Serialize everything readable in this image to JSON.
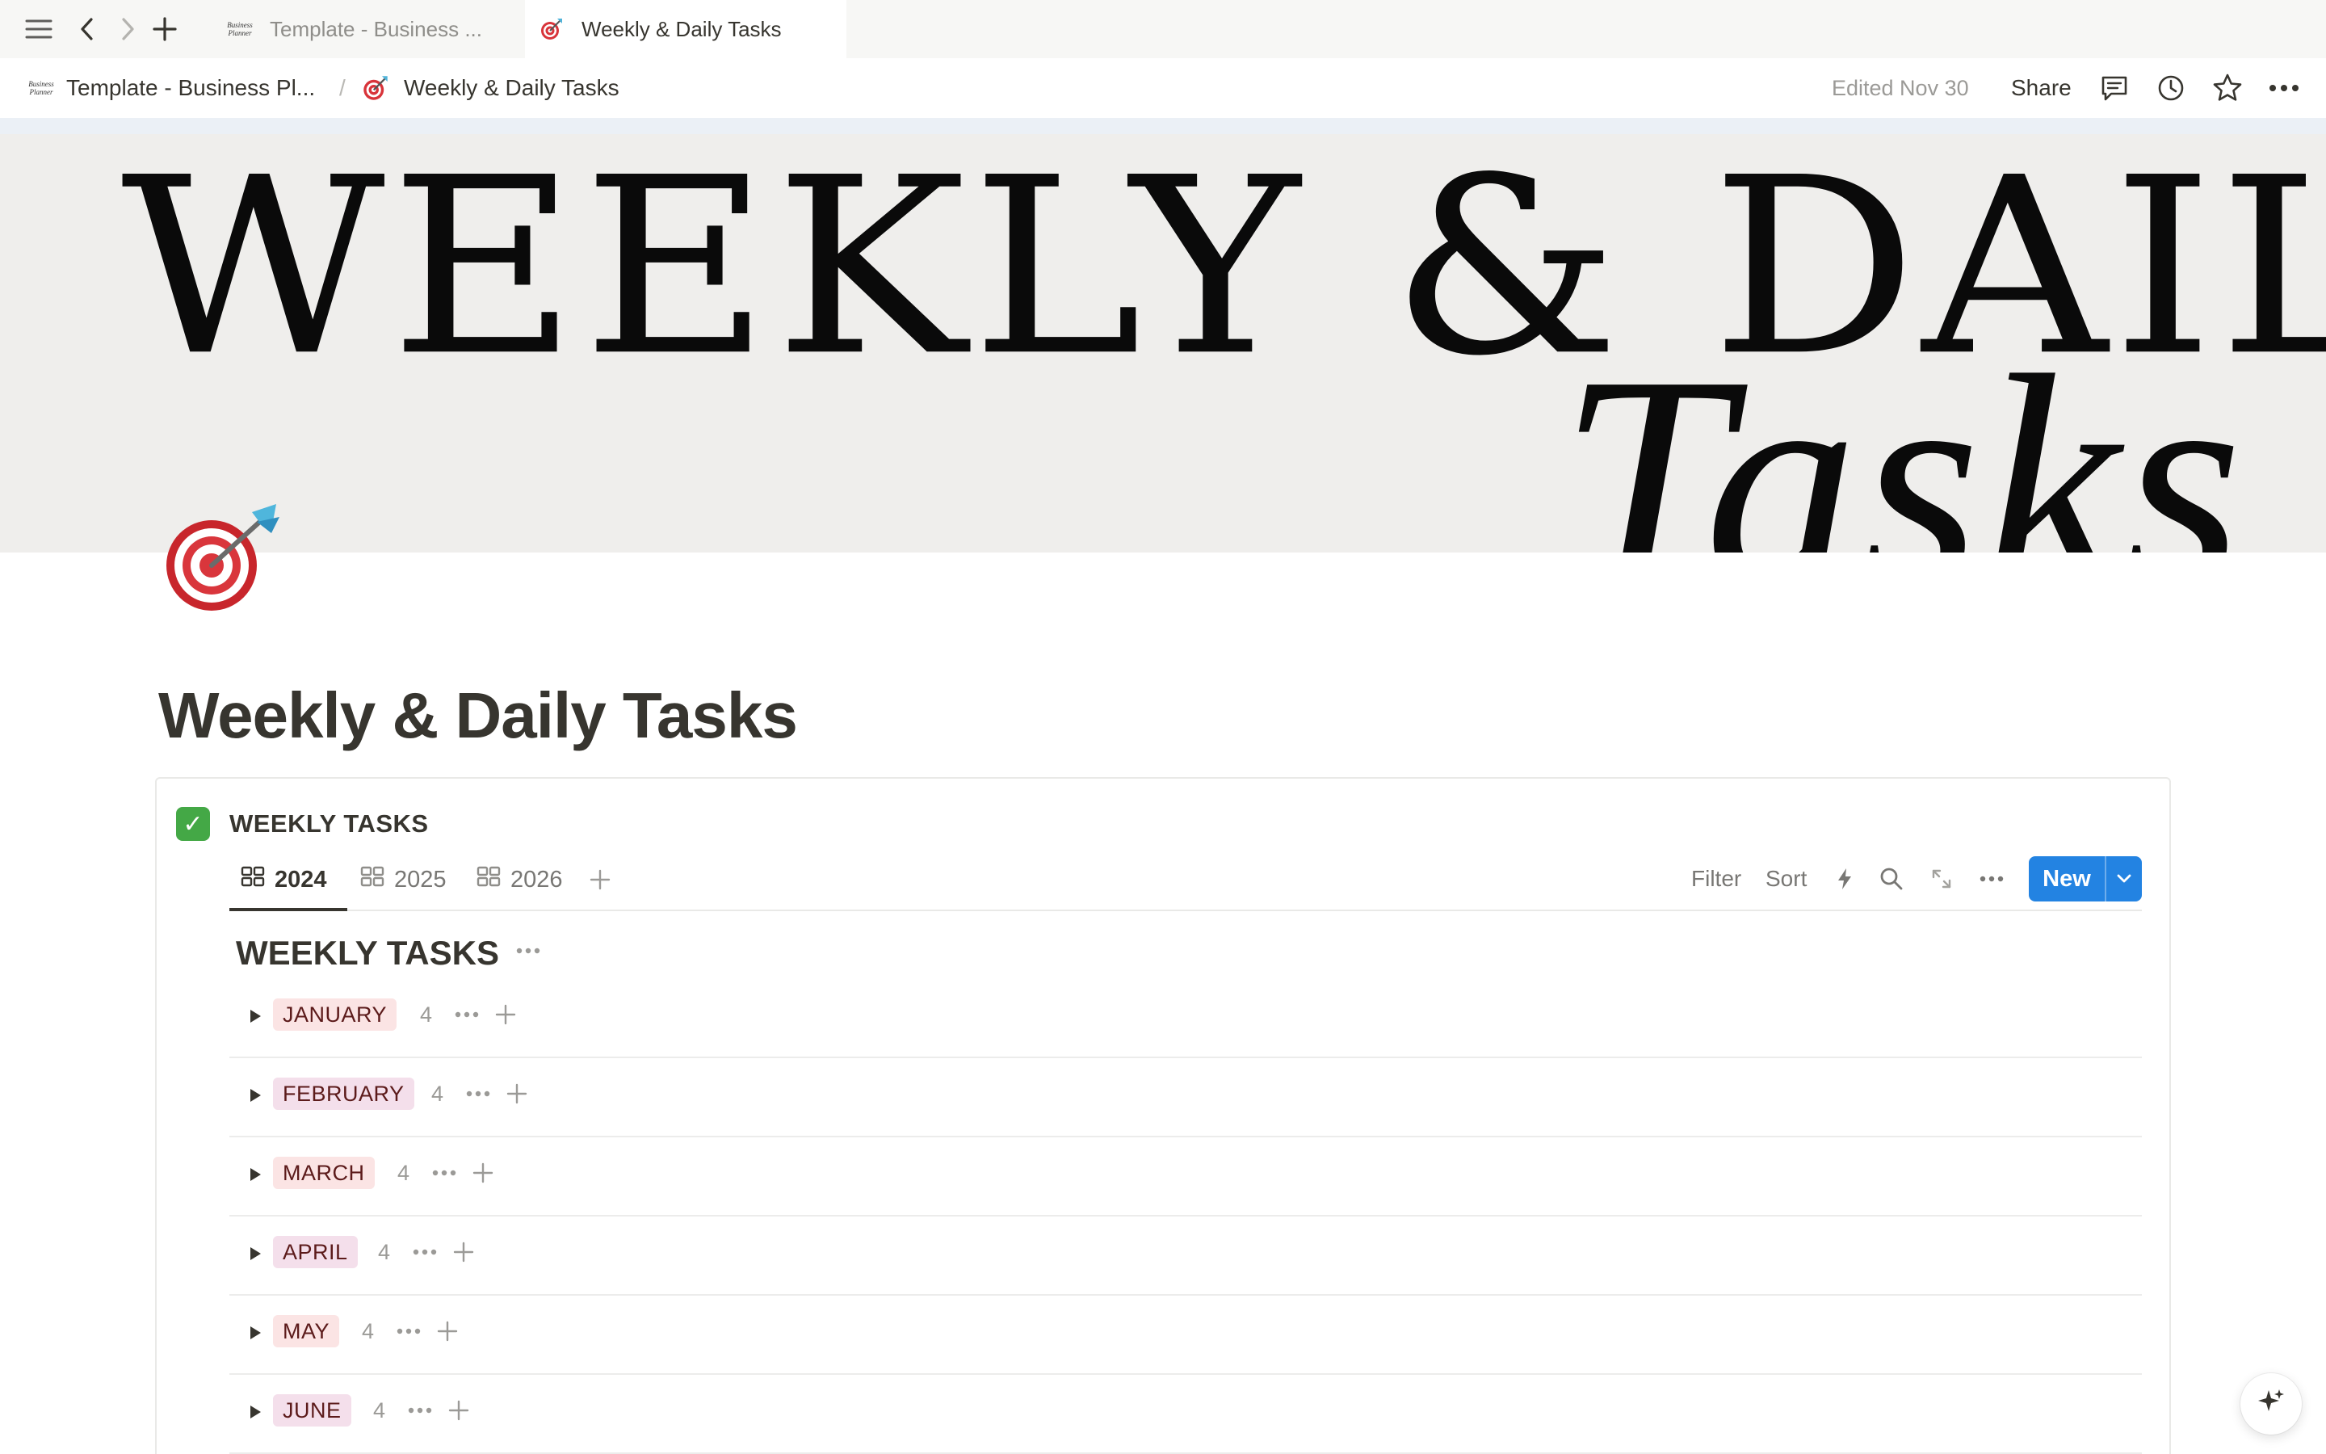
{
  "tabs": [
    {
      "label": "Template - Business ...",
      "active": false,
      "logo_text": [
        "Business",
        "Planner"
      ]
    },
    {
      "label": "Weekly & Daily Tasks",
      "active": true
    }
  ],
  "breadcrumb": {
    "parent": "Template - Business Pl...",
    "separator": "/",
    "current": "Weekly & Daily Tasks"
  },
  "topbar": {
    "edited": "Edited Nov 30",
    "share_label": "Share"
  },
  "cover": {
    "line1": "WEEKLY & DAILY",
    "line2": "Tasks"
  },
  "page": {
    "icon": "dart-target-icon",
    "title": "Weekly & Daily Tasks"
  },
  "database": {
    "title": "WEEKLY TASKS",
    "icon": "check-mark-icon",
    "views": [
      {
        "label": "2024",
        "active": true
      },
      {
        "label": "2025",
        "active": false
      },
      {
        "label": "2026",
        "active": false
      }
    ],
    "toolbar": {
      "filter_label": "Filter",
      "sort_label": "Sort",
      "new_label": "New"
    },
    "board_title": "WEEKLY TASKS",
    "groups": [
      {
        "label": "JANUARY",
        "count": "4",
        "color": "#fbe4e4"
      },
      {
        "label": "FEBRUARY",
        "count": "4",
        "color": "#f4dfeb"
      },
      {
        "label": "MARCH",
        "count": "4",
        "color": "#fbe4e4"
      },
      {
        "label": "APRIL",
        "count": "4",
        "color": "#f4dfeb"
      },
      {
        "label": "MAY",
        "count": "4",
        "color": "#fbe4e4"
      },
      {
        "label": "JUNE",
        "count": "4",
        "color": "#f4dfeb"
      }
    ]
  },
  "colors": {
    "accent": "#2383e2",
    "text": "#37352f",
    "muted": "#9b9a97",
    "cover_bg": "#efeeec",
    "check_green": "#44a846"
  }
}
